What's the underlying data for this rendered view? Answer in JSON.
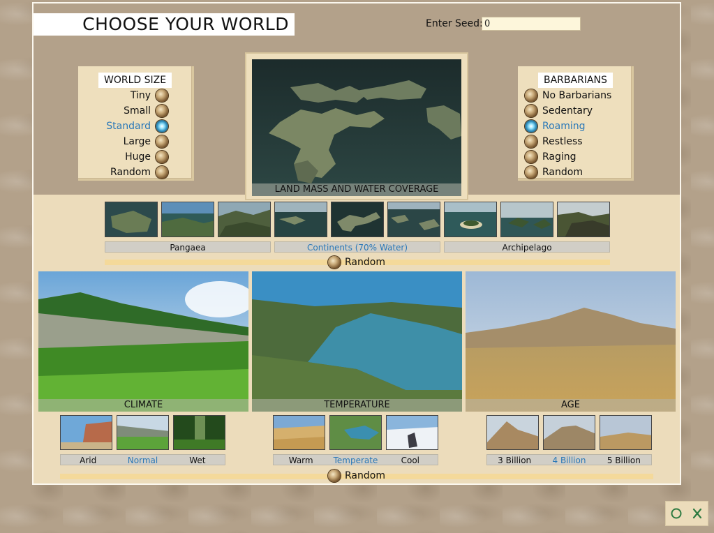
{
  "header": {
    "title": "CHOOSE YOUR WORLD",
    "seed_label": "Enter Seed:",
    "seed_value": "0"
  },
  "world_size": {
    "heading": "WORLD SIZE",
    "options": [
      "Tiny",
      "Small",
      "Standard",
      "Large",
      "Huge",
      "Random"
    ],
    "selected": "Standard"
  },
  "barbarians": {
    "heading": "BARBARIANS",
    "options": [
      "No Barbarians",
      "Sedentary",
      "Roaming",
      "Restless",
      "Raging",
      "Random"
    ],
    "selected": "Roaming"
  },
  "land": {
    "caption": "LAND MASS AND WATER COVERAGE",
    "groups": [
      "Pangaea",
      "Continents (70% Water)",
      "Archipelago"
    ],
    "selected": "Continents (70% Water)",
    "random_label": "Random"
  },
  "climate": {
    "caption": "CLIMATE",
    "options": [
      "Arid",
      "Normal",
      "Wet"
    ],
    "selected": "Normal"
  },
  "temperature": {
    "caption": "TEMPERATURE",
    "options": [
      "Warm",
      "Temperate",
      "Cool"
    ],
    "selected": "Temperate"
  },
  "age": {
    "caption": "AGE",
    "options": [
      "3 Billion",
      "4 Billion",
      "5 Billion"
    ],
    "selected": "4 Billion"
  },
  "bottom_random_label": "Random",
  "colors": {
    "selected_text": "#2a78b8",
    "panel_bg": "#ecdcbb",
    "top_bg": "#b3a18a"
  }
}
